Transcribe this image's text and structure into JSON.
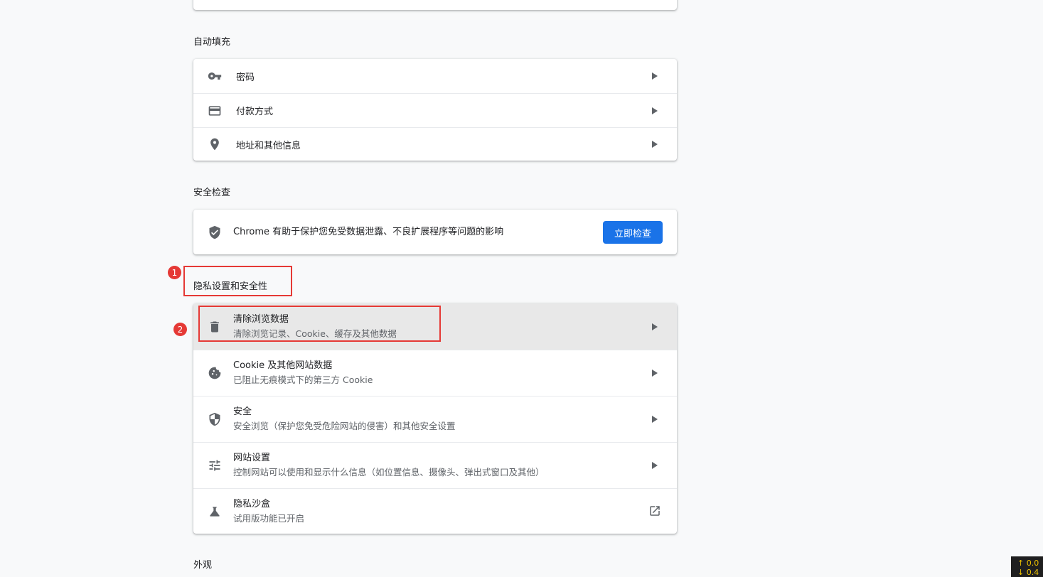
{
  "autofill": {
    "title": "自动填充",
    "items": [
      {
        "label": "密码",
        "icon": "key-icon"
      },
      {
        "label": "付款方式",
        "icon": "credit-card-icon"
      },
      {
        "label": "地址和其他信息",
        "icon": "location-pin-icon"
      }
    ]
  },
  "safety_check": {
    "title": "安全检查",
    "description": "Chrome 有助于保护您免受数据泄露、不良扩展程序等问题的影响",
    "button": "立即检查",
    "icon": "shield-check-icon"
  },
  "privacy": {
    "title": "隐私设置和安全性",
    "items": [
      {
        "primary": "清除浏览数据",
        "secondary": "清除浏览记录、Cookie、缓存及其他数据",
        "icon": "trash-icon"
      },
      {
        "primary": "Cookie 及其他网站数据",
        "secondary": "已阻止无痕模式下的第三方 Cookie",
        "icon": "cookie-icon"
      },
      {
        "primary": "安全",
        "secondary": "安全浏览（保护您免受危险网站的侵害）和其他安全设置",
        "icon": "security-shield-icon"
      },
      {
        "primary": "网站设置",
        "secondary": "控制网站可以使用和显示什么信息（如位置信息、摄像头、弹出式窗口及其他）",
        "icon": "tune-icon"
      },
      {
        "primary": "隐私沙盒",
        "secondary": "试用版功能已开启",
        "icon": "flask-icon"
      }
    ]
  },
  "appearance": {
    "title": "外观"
  },
  "annotations": {
    "badge1": "1",
    "badge2": "2"
  },
  "corner_widget": {
    "line1": "↑ 0.0",
    "line2": "↓ 0.4"
  },
  "colors": {
    "accent": "#1a73e8",
    "annotation_red": "#e53935",
    "highlight_row": "#e8e8e8"
  }
}
